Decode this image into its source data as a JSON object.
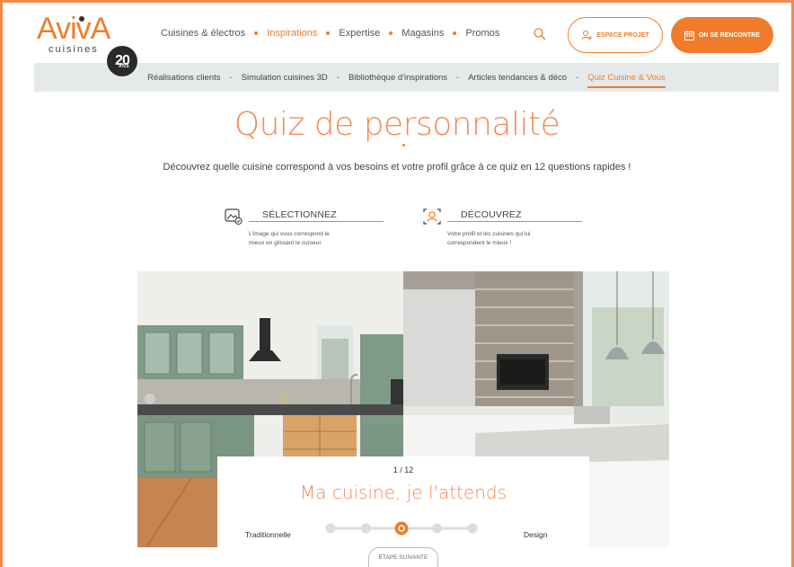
{
  "brand": {
    "name": "AvivA",
    "sub": "cuisines",
    "badge": "20",
    "badge_sub": "ANS",
    "accent": "#f07c2b"
  },
  "nav": {
    "items": [
      "Cuisines & électros",
      "Inspirations",
      "Expertise",
      "Magasins",
      "Promos"
    ],
    "active": "Inspirations",
    "search_icon": "search-icon",
    "projet_label": "ESPACE PROJET",
    "rencontre_label": "ON SE RENCONTRE"
  },
  "subnav": {
    "items": [
      "Réalisations clients",
      "Simulation cuisines 3D",
      "Bibliothèque d'inspirations",
      "Articles tendances & déco",
      "Quiz Cuisine & Vous"
    ],
    "separator": "-",
    "active": "Quiz Cuisine & Vous"
  },
  "hero": {
    "title": "Quiz de personnalité",
    "intro": "Découvrez quelle cuisine correspond à vos besoins et votre profil grâce à ce quiz en 12 questions rapides !"
  },
  "steps": [
    {
      "icon": "image-select-icon",
      "label": "SÉLECTIONNEZ",
      "desc_1": "L'image qui vous correspond le",
      "desc_2": "mieux en glissant le curseur"
    },
    {
      "icon": "profile-scan-icon",
      "label": "DÉCOUVREZ",
      "desc_1": "Votre profil et les cuisines qui lui",
      "desc_2": "correspondent le mieux !"
    }
  ],
  "quiz": {
    "counter": "1 / 12",
    "question": "Ma cuisine, je l'attends",
    "left_label": "Traditionnelle",
    "right_label": "Design",
    "slider_steps": 5,
    "slider_position": 0.5,
    "next_label": "ÉTAPE SUIVANTE"
  }
}
